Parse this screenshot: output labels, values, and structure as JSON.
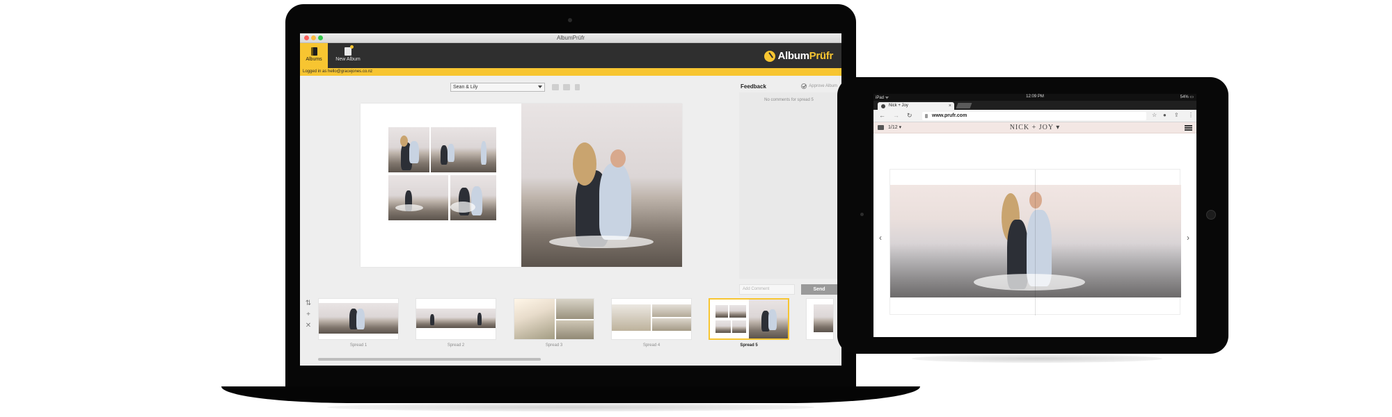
{
  "laptop": {
    "window_title": "AlbumPrüfr",
    "toolbar": {
      "albums_label": "Albums",
      "new_album_label": "New Album",
      "brand_part1": "Album",
      "brand_part2": "Prüfr"
    },
    "logged_in_text": "Logged in as hello@gracejones.co.nz",
    "album_selector": {
      "selected": "Sean & Lily"
    },
    "feedback": {
      "title": "Feedback",
      "approve_label": "Approve Album",
      "empty_text": "No comments for spread 5",
      "comment_placeholder": "Add Comment",
      "send_label": "Send"
    },
    "side_tools": [
      "⇅",
      "+",
      "✕"
    ],
    "spreads": [
      {
        "label": "Spread 1",
        "selected": false
      },
      {
        "label": "Spread 2",
        "selected": false
      },
      {
        "label": "Spread 3",
        "selected": false
      },
      {
        "label": "Spread 4",
        "selected": false
      },
      {
        "label": "Spread 5",
        "selected": true
      }
    ]
  },
  "tablet": {
    "status": {
      "left": "iPad ᯤ",
      "time": "12:09 PM",
      "right": "54% ▭"
    },
    "tab_title": "Nick + Joy",
    "url": "www.prufr.com",
    "page_counter": "1/12 ▾",
    "album_title": "NICK + JOY ▾"
  },
  "colors": {
    "accent": "#f7c531",
    "toolbar": "#2f2f2f",
    "nav_blush": "#f3e7e4"
  }
}
